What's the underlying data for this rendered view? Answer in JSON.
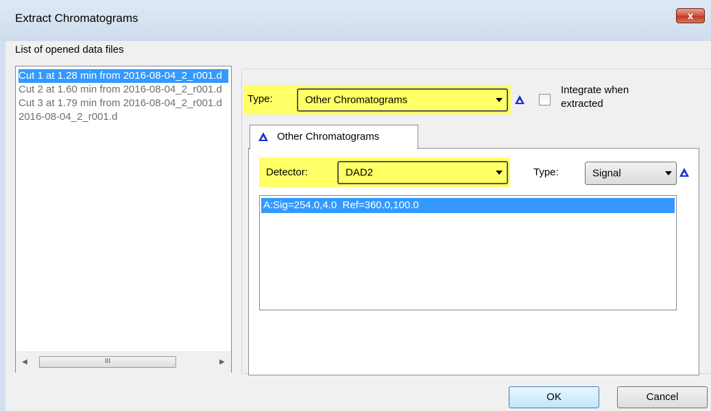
{
  "window": {
    "title": "Extract Chromatograms",
    "close_glyph": "x"
  },
  "files": {
    "label": "List of opened data files",
    "items": [
      "Cut 1 at 1.28 min from 2016-08-04_2_r001.d",
      "Cut 2 at 1.60 min from 2016-08-04_2_r001.d",
      "Cut 3 at 1.79 min from 2016-08-04_2_r001.d",
      "2016-08-04_2_r001.d"
    ],
    "selected_index": 0,
    "scroll_thumb_glyph": "III"
  },
  "extract": {
    "type_label": "Type:",
    "type_value": "Other Chromatograms",
    "integrate_label_line1": "Integrate when",
    "integrate_label_line2": "extracted",
    "integrate_checked": false
  },
  "tab": {
    "label": "Other Chromatograms"
  },
  "detector": {
    "label": "Detector:",
    "value": "DAD2",
    "type_label": "Type:",
    "type_value": "Signal"
  },
  "signals": {
    "items": [
      "A:Sig=254.0,4.0  Ref=360.0,100.0"
    ]
  },
  "buttons": {
    "ok": "OK",
    "cancel": "Cancel"
  },
  "colors": {
    "highlight": "#ffff66",
    "selection": "#3399ff",
    "icon_blue": "#1a2fd6"
  }
}
